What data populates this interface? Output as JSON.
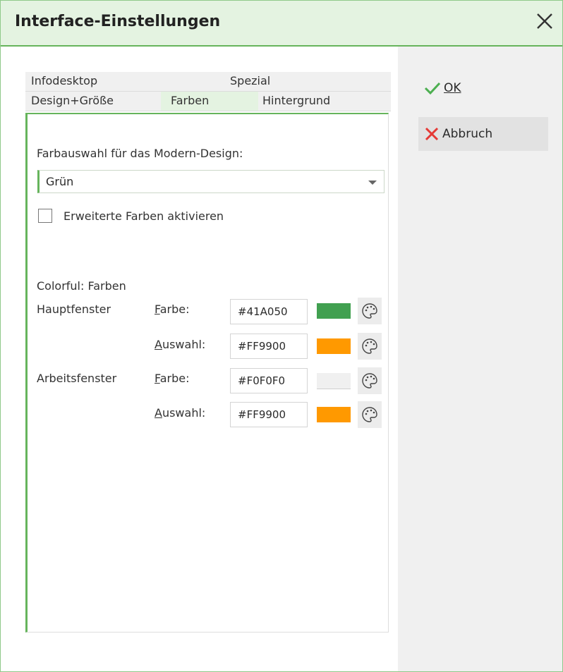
{
  "window": {
    "title": "Interface-Einstellungen"
  },
  "buttons": {
    "ok": "OK",
    "cancel": "Abbruch"
  },
  "tabs": {
    "row1": [
      "Infodesktop",
      "Spezial"
    ],
    "row2": [
      "Design+Größe",
      "Farben",
      "Hintergrund"
    ],
    "active": "Farben"
  },
  "design": {
    "label": "Farbauswahl für das Modern-Design:",
    "selected": "Grün",
    "extended_checkbox_label": "Erweiterte Farben aktivieren",
    "extended_checked": false
  },
  "colorful": {
    "heading": "Colorful: Farben",
    "rows": [
      {
        "section": "Hauptfenster",
        "field": "Farbe:",
        "hex": "#41A050",
        "swatch": "#41A050"
      },
      {
        "section": "",
        "field": "Auswahl:",
        "hex": "#FF9900",
        "swatch": "#FF9900"
      },
      {
        "section": "Arbeitsfenster",
        "field": "Farbe:",
        "hex": "#F0F0F0",
        "swatch": "#F0F0F0"
      },
      {
        "section": "",
        "field": "Auswahl:",
        "hex": "#FF9900",
        "swatch": "#FF9900"
      }
    ]
  },
  "colors": {
    "accent": "#66B45C",
    "titlebar": "#E4F3E1",
    "ok_icon": "#4CAF50",
    "cancel_icon": "#E53935"
  },
  "icons": {
    "close": "close-icon",
    "ok": "checkmark-icon",
    "cancel": "x-icon",
    "palette": "palette-icon",
    "dropdown": "chevron-down-icon"
  }
}
